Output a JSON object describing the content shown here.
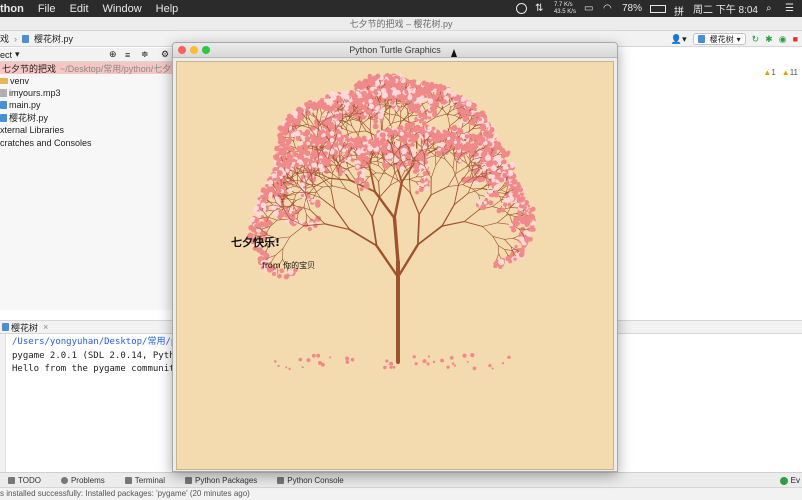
{
  "menubar": {
    "app": "thon",
    "menus": [
      "File",
      "Edit",
      "Window",
      "Help"
    ],
    "net_up": "7.7 K/s",
    "net_down": "43.5 K/s",
    "battery": "78%",
    "clock": "周二 下午 8:04"
  },
  "ide": {
    "title": "七夕节的把戏 – 樱花树.py",
    "breadcrumb_left": "戏",
    "breadcrumb_file": "樱花树.py",
    "run_config": "樱花树",
    "warnings": "1",
    "weak_warnings": "11"
  },
  "project": {
    "header": "ect",
    "items": [
      {
        "label": "七夕节的把戏",
        "path": "~/Desktop/常用/python/七夕节的",
        "selected": true
      },
      {
        "label": "venv",
        "type": "folder"
      },
      {
        "label": "imyours.mp3",
        "type": "mp3"
      },
      {
        "label": "main.py",
        "type": "py"
      },
      {
        "label": "樱花树.py",
        "type": "py"
      },
      {
        "label": "xternal Libraries",
        "type": "lib"
      },
      {
        "label": "cratches and Consoles",
        "type": "scratch"
      }
    ]
  },
  "run": {
    "tab": "樱花树",
    "lines": [
      "/Users/yongyuhan/Desktop/常用/pyth",
      "pygame 2.0.1 (SDL 2.0.14, Python",
      "Hello from the pygame community."
    ]
  },
  "tool_tabs": [
    "TODO",
    "Problems",
    "Terminal",
    "Python Packages",
    "Python Console"
  ],
  "event_log": "Ev",
  "status": "s installed successfully: Installed packages: 'pygame' (20 minutes ago)",
  "turtle": {
    "title": "Python Turtle Graphics",
    "greeting": "七夕快乐!",
    "from_line": "from 你的宝贝"
  },
  "colors": {
    "canvas_bg": "#f4dbaf",
    "branch": "#a0522d",
    "blossom": "#f08a8a",
    "blossom_light": "#ffd9d9",
    "selection": "#f7c6c4"
  }
}
